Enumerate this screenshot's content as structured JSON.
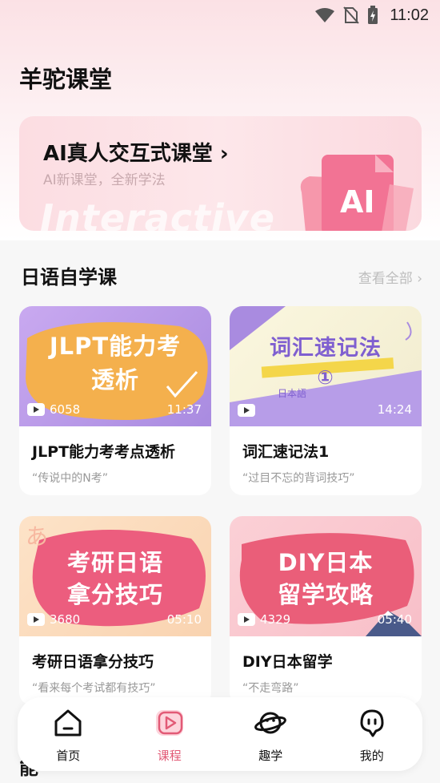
{
  "status": {
    "time": "11:02"
  },
  "header": {
    "title": "羊驼课堂"
  },
  "ai_banner": {
    "title": "AI真人交互式课堂 ›",
    "subtitle": "AI新课堂，全新学法",
    "watermark": "Interactive",
    "badge": "AI"
  },
  "section": {
    "title": "日语自学课",
    "view_all": "查看全部 ›"
  },
  "courses": [
    {
      "thumb_text": [
        "JLPT能力考",
        "透析"
      ],
      "plays": "6058",
      "duration": "11:37",
      "title": "JLPT能力考考点透析",
      "subtitle": "“传说中的N考”",
      "accent": "#f0a94a"
    },
    {
      "thumb_text": [
        "词汇速记法",
        "①"
      ],
      "plays": "",
      "duration": "14:24",
      "title": "词汇速记法1",
      "subtitle": "“过目不忘的背词技巧”",
      "accent": "#7f5fd0",
      "footer_text": "日本語"
    },
    {
      "thumb_text": [
        "考研日语",
        "拿分技巧"
      ],
      "plays": "3680",
      "duration": "05:10",
      "title": "考研日语拿分技巧",
      "subtitle": "“看来每个考试都有技巧”",
      "accent": "#e95b7a",
      "corner_char": "あ"
    },
    {
      "thumb_text": [
        "DIY日本",
        "留学攻略"
      ],
      "plays": "4329",
      "duration": "05:40",
      "title": "DIY日本留学",
      "subtitle": "“不走弯路”",
      "accent": "#ea5e79"
    }
  ],
  "nav": [
    {
      "label": "首页",
      "icon": "home-icon"
    },
    {
      "label": "课程",
      "icon": "play-square-icon",
      "active": true
    },
    {
      "label": "趣学",
      "icon": "planet-icon"
    },
    {
      "label": "我的",
      "icon": "ghost-icon"
    }
  ],
  "peek_text": "能"
}
